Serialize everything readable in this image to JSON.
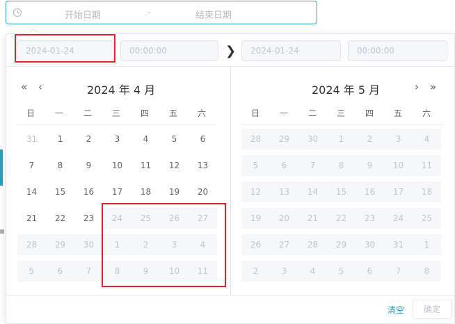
{
  "range_input": {
    "start_placeholder": "开始日期",
    "separator": "-",
    "end_placeholder": "结束日期"
  },
  "header": {
    "start_date": "2024-01-24",
    "start_time": "00:00:00",
    "end_date": "2024-01-24",
    "end_time": "00:00:00"
  },
  "weekdays": [
    "日",
    "一",
    "二",
    "三",
    "四",
    "五",
    "六"
  ],
  "left_calendar": {
    "title": "2024 年 4 月",
    "nav_prev_year": "«",
    "nav_prev_month": "‹",
    "rows": [
      [
        {
          "d": "31",
          "s": "oth"
        },
        {
          "d": "1",
          "s": "cur"
        },
        {
          "d": "2",
          "s": "cur"
        },
        {
          "d": "3",
          "s": "cur"
        },
        {
          "d": "4",
          "s": "cur"
        },
        {
          "d": "5",
          "s": "cur"
        },
        {
          "d": "6",
          "s": "cur"
        }
      ],
      [
        {
          "d": "7",
          "s": "cur"
        },
        {
          "d": "8",
          "s": "cur"
        },
        {
          "d": "9",
          "s": "cur"
        },
        {
          "d": "10",
          "s": "cur"
        },
        {
          "d": "11",
          "s": "cur"
        },
        {
          "d": "12",
          "s": "cur"
        },
        {
          "d": "13",
          "s": "cur"
        }
      ],
      [
        {
          "d": "14",
          "s": "cur"
        },
        {
          "d": "15",
          "s": "cur"
        },
        {
          "d": "16",
          "s": "cur"
        },
        {
          "d": "17",
          "s": "cur"
        },
        {
          "d": "18",
          "s": "cur"
        },
        {
          "d": "19",
          "s": "cur"
        },
        {
          "d": "20",
          "s": "cur"
        }
      ],
      [
        {
          "d": "21",
          "s": "cur"
        },
        {
          "d": "22",
          "s": "cur"
        },
        {
          "d": "23",
          "s": "cur"
        },
        {
          "d": "24",
          "s": "dis"
        },
        {
          "d": "25",
          "s": "dis"
        },
        {
          "d": "26",
          "s": "dis"
        },
        {
          "d": "27",
          "s": "dis"
        }
      ],
      [
        {
          "d": "28",
          "s": "dis"
        },
        {
          "d": "29",
          "s": "dis"
        },
        {
          "d": "30",
          "s": "dis"
        },
        {
          "d": "1",
          "s": "dis"
        },
        {
          "d": "2",
          "s": "dis"
        },
        {
          "d": "3",
          "s": "dis"
        },
        {
          "d": "4",
          "s": "dis"
        }
      ],
      [
        {
          "d": "5",
          "s": "dis"
        },
        {
          "d": "6",
          "s": "dis"
        },
        {
          "d": "7",
          "s": "dis"
        },
        {
          "d": "8",
          "s": "dis"
        },
        {
          "d": "9",
          "s": "dis"
        },
        {
          "d": "10",
          "s": "dis"
        },
        {
          "d": "11",
          "s": "dis"
        }
      ]
    ]
  },
  "right_calendar": {
    "title": "2024 年 5 月",
    "nav_next_month": "›",
    "nav_next_year": "»",
    "rows": [
      [
        {
          "d": "28",
          "s": "dis"
        },
        {
          "d": "29",
          "s": "dis"
        },
        {
          "d": "30",
          "s": "dis"
        },
        {
          "d": "1",
          "s": "dis"
        },
        {
          "d": "2",
          "s": "dis"
        },
        {
          "d": "3",
          "s": "dis"
        },
        {
          "d": "4",
          "s": "dis"
        }
      ],
      [
        {
          "d": "5",
          "s": "dis"
        },
        {
          "d": "6",
          "s": "dis"
        },
        {
          "d": "7",
          "s": "dis"
        },
        {
          "d": "8",
          "s": "dis"
        },
        {
          "d": "9",
          "s": "dis"
        },
        {
          "d": "10",
          "s": "dis"
        },
        {
          "d": "11",
          "s": "dis"
        }
      ],
      [
        {
          "d": "12",
          "s": "dis"
        },
        {
          "d": "13",
          "s": "dis"
        },
        {
          "d": "14",
          "s": "dis"
        },
        {
          "d": "15",
          "s": "dis"
        },
        {
          "d": "16",
          "s": "dis"
        },
        {
          "d": "17",
          "s": "dis"
        },
        {
          "d": "18",
          "s": "dis"
        }
      ],
      [
        {
          "d": "19",
          "s": "dis"
        },
        {
          "d": "20",
          "s": "dis"
        },
        {
          "d": "21",
          "s": "dis"
        },
        {
          "d": "22",
          "s": "dis"
        },
        {
          "d": "23",
          "s": "dis"
        },
        {
          "d": "24",
          "s": "dis"
        },
        {
          "d": "25",
          "s": "dis"
        }
      ],
      [
        {
          "d": "26",
          "s": "dis"
        },
        {
          "d": "27",
          "s": "dis"
        },
        {
          "d": "28",
          "s": "dis"
        },
        {
          "d": "29",
          "s": "dis"
        },
        {
          "d": "30",
          "s": "dis"
        },
        {
          "d": "31",
          "s": "dis"
        },
        {
          "d": "1",
          "s": "dis"
        }
      ],
      [
        {
          "d": "2",
          "s": "dis"
        },
        {
          "d": "3",
          "s": "dis"
        },
        {
          "d": "4",
          "s": "dis"
        },
        {
          "d": "5",
          "s": "dis"
        },
        {
          "d": "6",
          "s": "dis"
        },
        {
          "d": "7",
          "s": "dis"
        },
        {
          "d": "8",
          "s": "dis"
        }
      ]
    ]
  },
  "footer": {
    "clear_label": "清空",
    "ok_label": "确定"
  },
  "colors": {
    "accent": "#2b9fb6",
    "highlight_box": "#e3242b",
    "disabled_bg": "#f5f7fa"
  }
}
